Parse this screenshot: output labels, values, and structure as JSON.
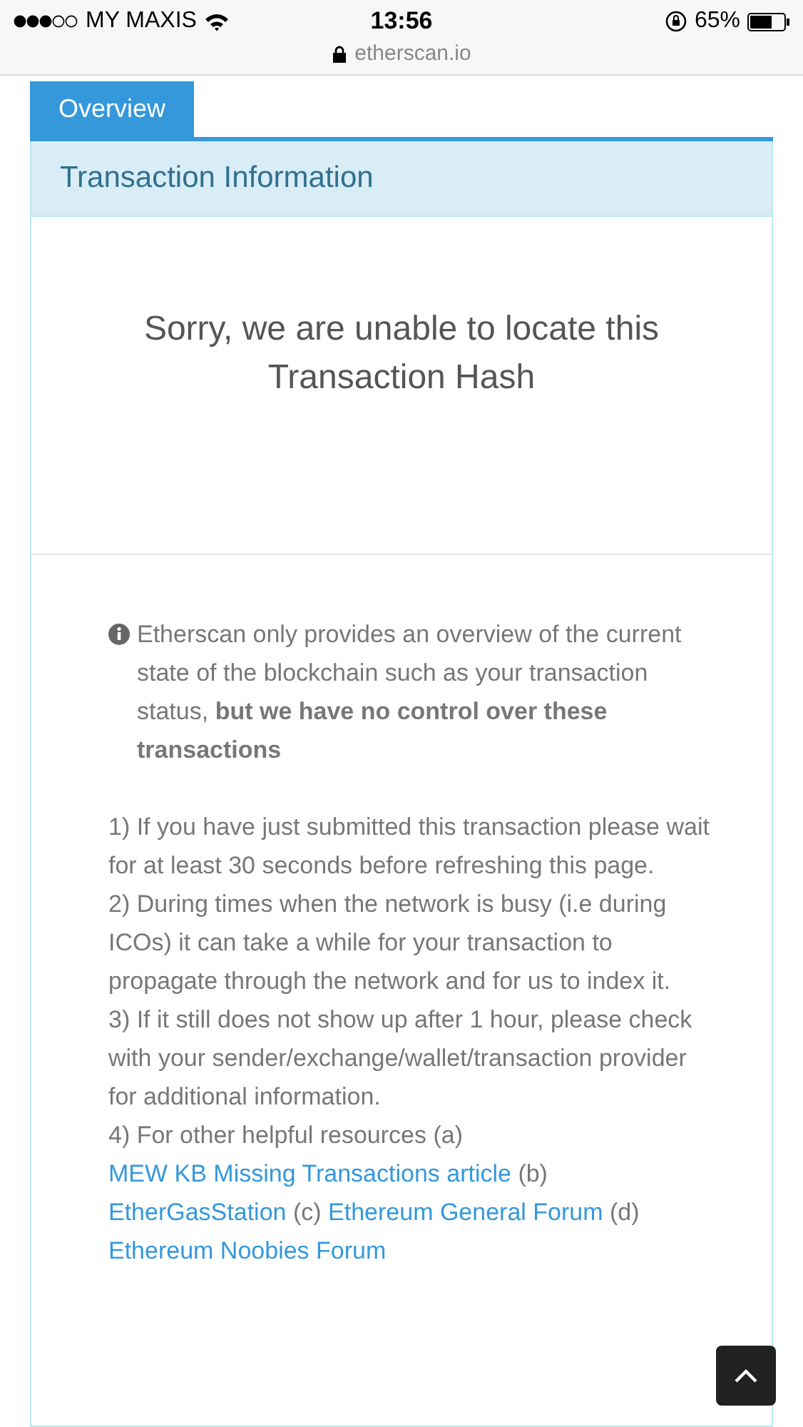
{
  "status_bar": {
    "carrier": "MY MAXIS",
    "time": "13:56",
    "battery": "65%"
  },
  "address_bar": {
    "url": "etherscan.io"
  },
  "tabs": [
    {
      "label": "Overview",
      "selected": true
    }
  ],
  "panel": {
    "title": "Transaction Information",
    "message": "Sorry, we are unable to locate this Transaction Hash",
    "notice": "Etherscan only provides an overview of the current state of the blockchain such as your transaction status, **but we have no control over these transactions**",
    "steps": [
      "1) If you have just submitted this transaction please wait for at least 30 seconds before refreshing this page.",
      "2) During times when the network is busy (i.e during ICOs) it can take a while for your transaction to propagate through the network and for us to index it.",
      "3) If it still does not show up after 1 hour, please check with your sender/exchange/wallet/transaction provider for additional information."
    ],
    "resources": [
      {
        "kind": "text",
        "text": "4) For other helpful resources (a) "
      },
      {
        "kind": "link",
        "text": "MEW KB Missing Transactions article"
      },
      {
        "kind": "text",
        "text": "  (b) "
      },
      {
        "kind": "link",
        "text": "EtherGasStation"
      },
      {
        "kind": "text",
        "text": " (c) "
      },
      {
        "kind": "link",
        "text": "Ethereum General Forum"
      },
      {
        "kind": "text",
        "text": " (d) "
      },
      {
        "kind": "link",
        "text": "Ethereum Noobies Forum"
      }
    ]
  }
}
